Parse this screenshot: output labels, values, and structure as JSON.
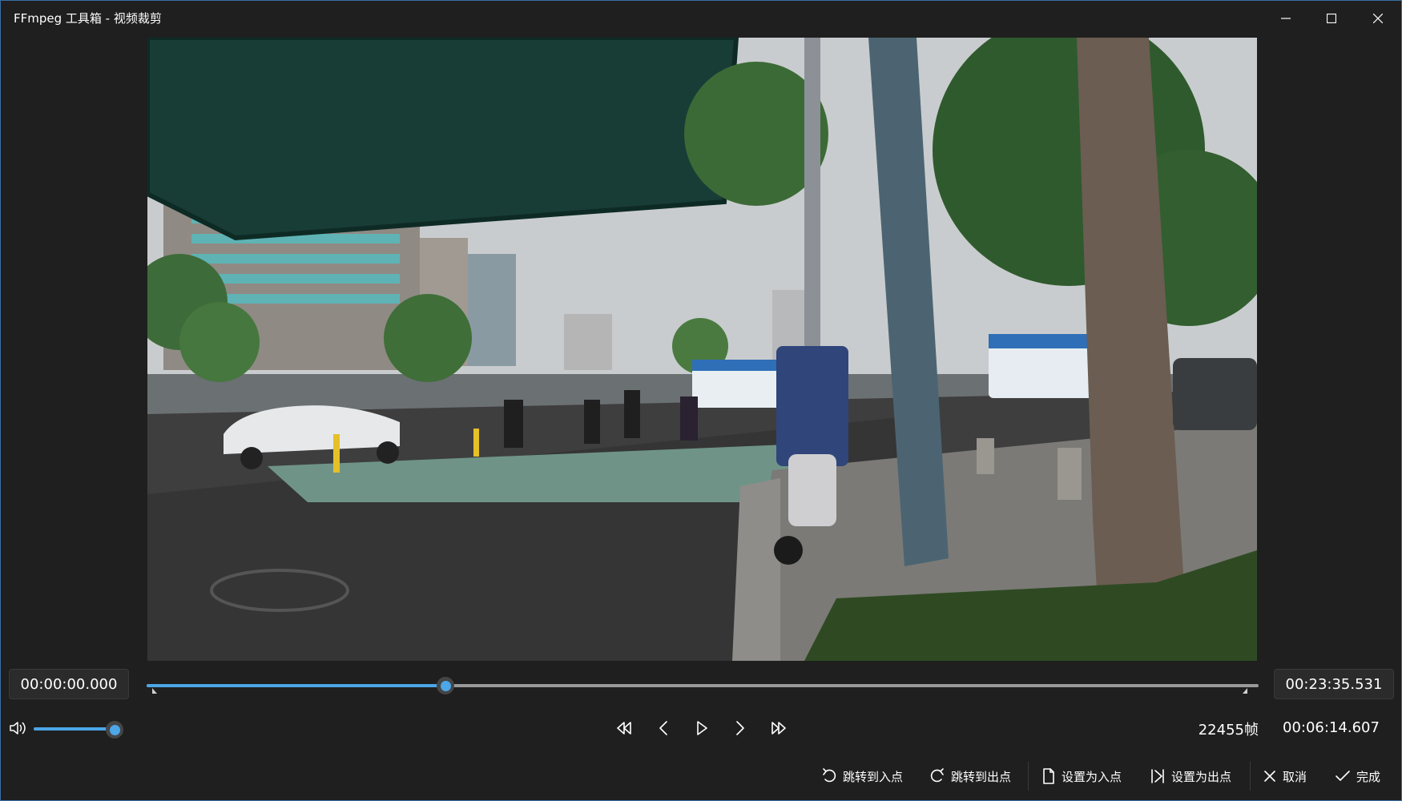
{
  "window": {
    "title": "FFmpeg 工具箱 - 视频裁剪",
    "minimize_icon": "minimize-icon",
    "maximize_icon": "maximize-icon",
    "close_icon": "close-icon"
  },
  "player": {
    "start_time": "00:00:00.000",
    "end_time": "00:23:35.531",
    "seek_position": 0.269,
    "volume_level": 0.88,
    "frame_count": "22455帧",
    "current_time": "00:06:14.607",
    "accent_color": "#4ca6e8"
  },
  "controls": [
    {
      "name": "skip-back-icon"
    },
    {
      "name": "previous-frame-icon"
    },
    {
      "name": "play-icon"
    },
    {
      "name": "next-frame-icon"
    },
    {
      "name": "skip-forward-icon"
    }
  ],
  "actions": {
    "goto_in": "跳转到入点",
    "goto_out": "跳转到出点",
    "set_in": "设置为入点",
    "set_out": "设置为出点",
    "cancel": "取消",
    "done": "完成"
  }
}
